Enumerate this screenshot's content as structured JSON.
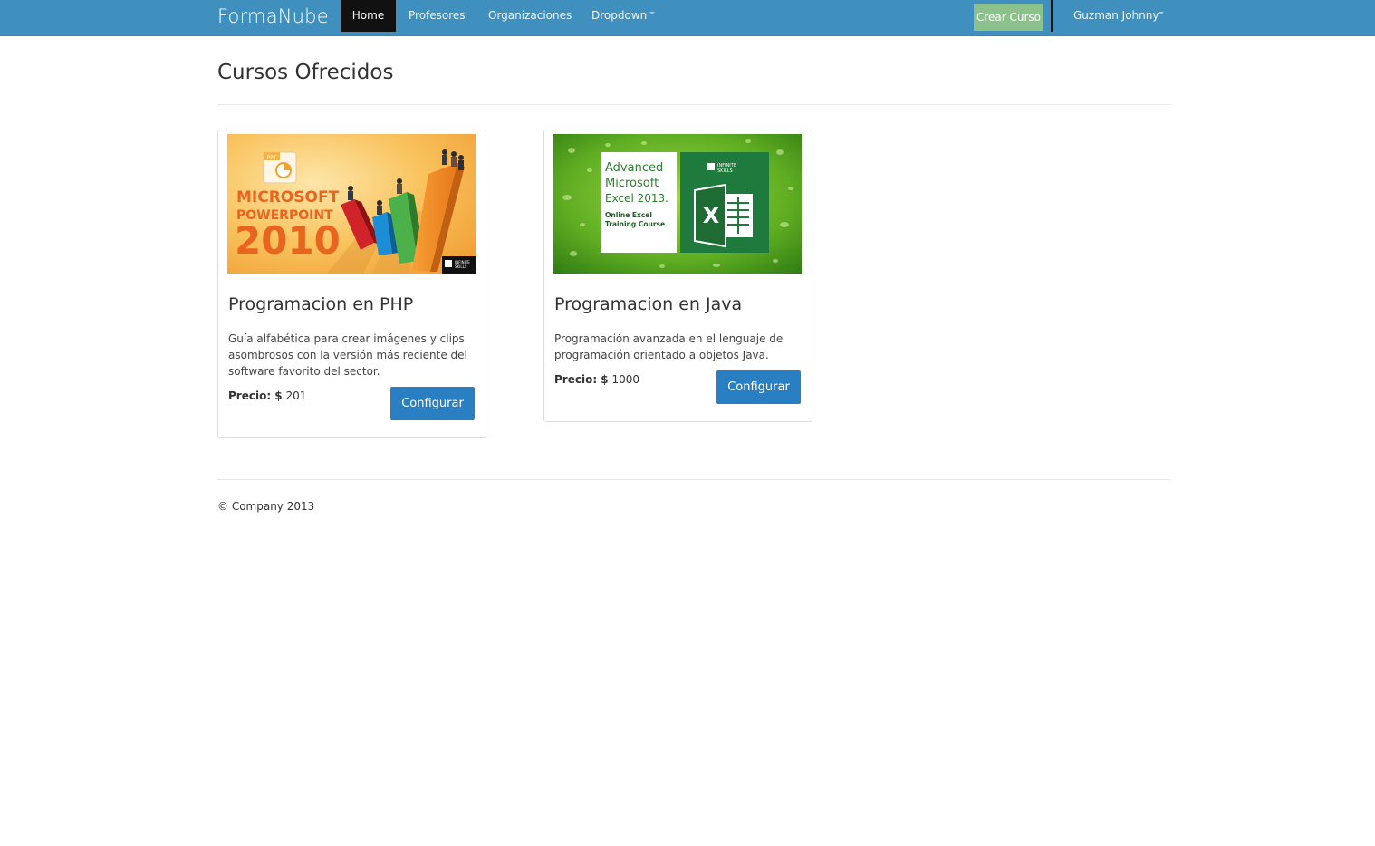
{
  "navbar": {
    "brand": "FormaNube",
    "items": [
      {
        "label": "Home",
        "active": true
      },
      {
        "label": "Profesores"
      },
      {
        "label": "Organizaciones"
      },
      {
        "label": "Dropdown"
      }
    ],
    "create_button": "Crear Curso",
    "user_name": "Guzman Johnny",
    "colors": {
      "bar": "#3f8fbf",
      "active": "#111111",
      "create_button": "#8bc28b"
    }
  },
  "page": {
    "title": "Cursos Ofrecidos"
  },
  "courses": [
    {
      "title": "Programacion en PHP",
      "description": "Guía alfabética para crear imágenes y clips asombrosos con la versión más reciente del software favorito del sector.",
      "price_label": "Precio: $",
      "price_value": "201",
      "button": "Configurar",
      "image": {
        "badge": "PPT",
        "line1": "MICROSOFT",
        "line2": "POWERPOINT",
        "line3": "2010",
        "logo_line1": "INFINITE",
        "logo_line2": "SKILLS"
      }
    },
    {
      "title": "Programacion en Java",
      "description": "Programación avanzada en el lenguaje de programación orientado a objetos Java.",
      "price_label": "Precio: $",
      "price_value": "1000",
      "button": "Configurar",
      "image": {
        "line1": "Advanced",
        "line2": "Microsoft",
        "line3": "Excel 2013.",
        "sub1": "Online Excel",
        "sub2": "Training Course",
        "logo_line1": "INFINITE",
        "logo_line2": "SKILLS",
        "icon_letter": "X"
      }
    }
  ],
  "footer": {
    "text": "© Company 2013"
  },
  "colors": {
    "primary_button": "#2a7ec2"
  }
}
